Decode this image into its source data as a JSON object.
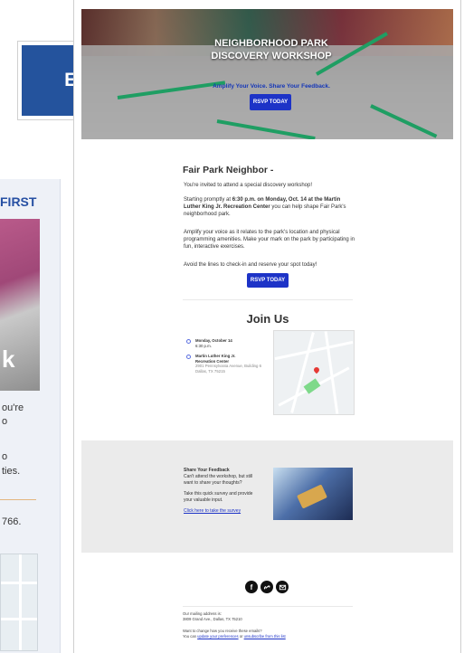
{
  "background_card": {
    "heading_fragment": "FIRST",
    "photo_fragment": "k",
    "text_lines": [
      "ou're",
      "o",
      "o",
      "ties."
    ],
    "number_fragment": "766."
  },
  "badge": {
    "label": "EMAIL"
  },
  "hero": {
    "title_line1": "NEIGHBORHOOD PARK",
    "title_line2": "DISCOVERY WORKSHOP",
    "tagline": "Amplify Your Voice. Share Your Feedback.",
    "rsvp": "RSVP TODAY"
  },
  "content": {
    "greeting": "Fair Park Neighbor -",
    "p1": "You're invited to attend a special discovery workshop!",
    "p2_a": "Starting promptly at ",
    "p2_b": "6:30 p.m. on Monday, Oct. 14 at the Martin Luther King Jr. Recreation Center",
    "p2_c": " you can help shape Fair Park's neighborhood park.",
    "p3": "Amplify your voice as it relates to the park's location and physical programming amenities. Make your mark on the park by participating in fun, interactive exercises.",
    "p4": "Avoid the lines to check-in and reserve your spot today!",
    "rsvp": "RSVP TODAY"
  },
  "join": {
    "title": "Join Us",
    "date": "Monday, October 14",
    "time": "6:30 p.m.",
    "venue_line1": "Martin Luther King Jr.",
    "venue_line2": "Recreation Center",
    "address_line1": "2901 Pennsylvania Avenue, Building 6",
    "address_line2": "Dallas, TX 75215"
  },
  "feedback": {
    "title": "Share Your Feedback",
    "line1": "Can't attend the workshop, but still",
    "line2": "want to share your thoughts?",
    "line3": "Take this quick survey and provide",
    "line4": "your valuable input.",
    "link": "Click here to take the survey"
  },
  "social": {
    "facebook": "f",
    "link": "link-icon",
    "mail": "mail-icon"
  },
  "footer": {
    "mailing_label": "Our mailing address is:",
    "mailing_address": "3809 Grand Ave., Dallas, TX 75210",
    "prefs_question": "Want to change how you receive these emails?",
    "prefs_a": "You can ",
    "prefs_link1": "update your preferences",
    "prefs_b": " or ",
    "prefs_link2": "unsubscribe from this list"
  },
  "colors": {
    "badge": "#24539d",
    "button": "#1d33c7",
    "feedback_bg": "#ebebeb",
    "accent_green": "#1f9e63"
  }
}
